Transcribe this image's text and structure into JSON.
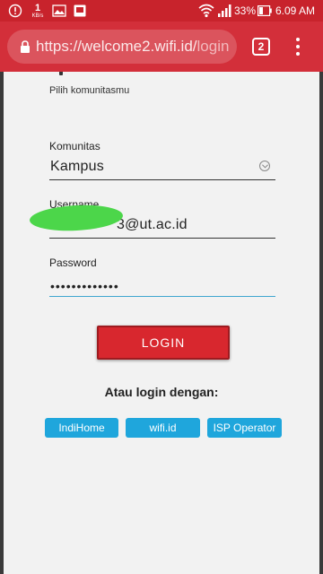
{
  "status_bar": {
    "net_speed": "1",
    "net_unit": "KB/s",
    "battery": "33%",
    "time": "6.09 AM"
  },
  "browser": {
    "url_main": "https://welcome2.wifi.id/",
    "url_rest": "login",
    "tab_count": "2"
  },
  "form": {
    "subtitle": "Pilih komunitasmu",
    "community_label": "Komunitas",
    "community_value": "Kampus",
    "username_label": "Username",
    "username_value": "3@ut.ac.id",
    "password_label": "Password",
    "password_value": "•••••••••••••",
    "login_button": "LOGIN",
    "alt_login_label": "Atau login dengan:",
    "alt_buttons": [
      "IndiHome",
      "wifi.id",
      "ISP Operator"
    ]
  },
  "colors": {
    "brand_red": "#d32f3a",
    "button_red": "#d8272e",
    "alt_button_blue": "#1fa6dc",
    "focus_blue": "#3fa6d0"
  },
  "icons": [
    "alert-icon",
    "image-icon",
    "gallery-icon",
    "wifi-icon",
    "signal-icon",
    "battery-icon",
    "lock-icon",
    "dropdown-icon",
    "overflow-menu-icon"
  ]
}
